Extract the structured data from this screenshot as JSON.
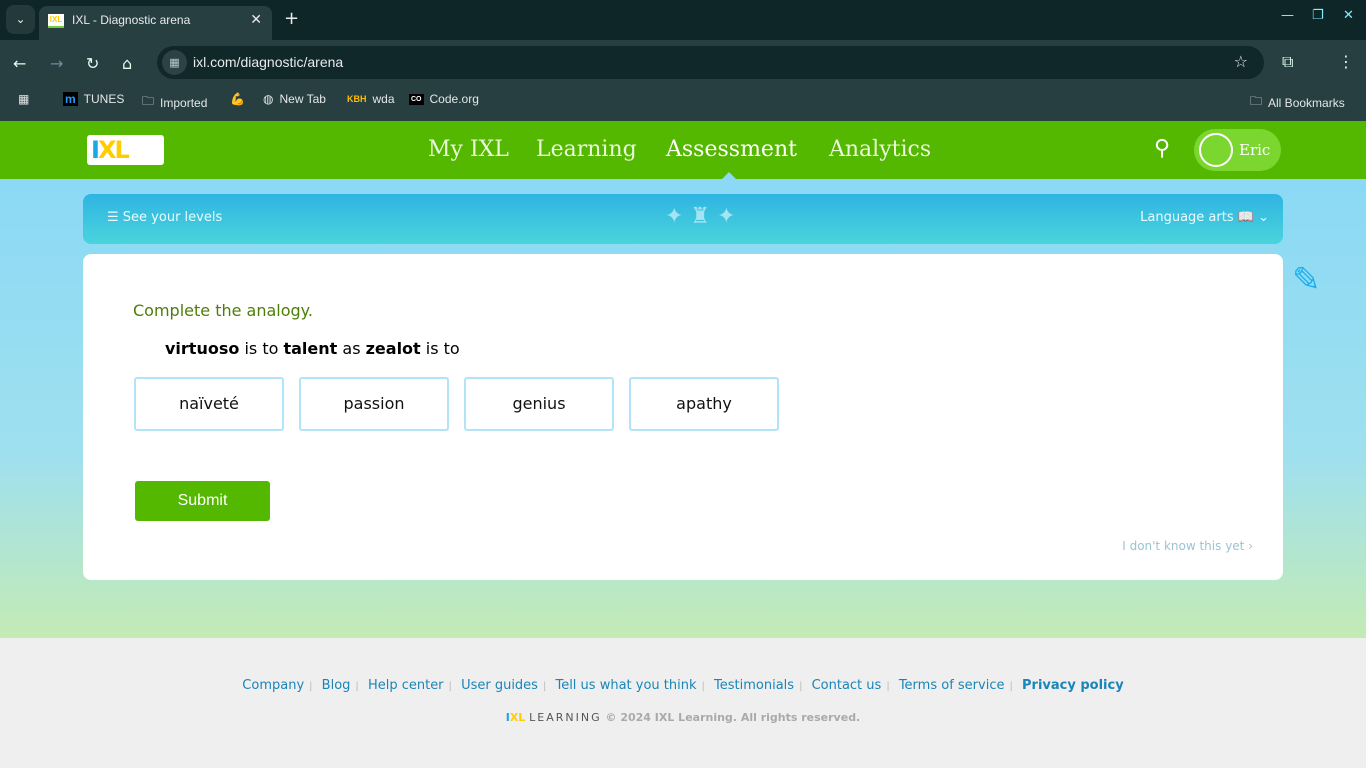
{
  "browser": {
    "tab_title": "IXL - Diagnostic arena",
    "url": "ixl.com/diagnostic/arena",
    "bookmarks": [
      {
        "label": "TUNES",
        "icon": "m-icon"
      },
      {
        "label": "Imported",
        "icon": "folder-icon"
      },
      {
        "label": "",
        "icon": "flexed-biceps-icon"
      },
      {
        "label": "New Tab",
        "icon": "globe-icon"
      },
      {
        "label": "wda",
        "icon": "kbh-icon"
      },
      {
        "label": "Code.org",
        "icon": "code-org-icon"
      }
    ],
    "all_bookmarks": "All Bookmarks"
  },
  "header": {
    "logo": "IXL",
    "nav": [
      "My IXL",
      "Learning",
      "Assessment",
      "Analytics"
    ],
    "active": "Assessment",
    "user": "Eric"
  },
  "banner": {
    "levels": "See your levels",
    "subject": "Language arts"
  },
  "question": {
    "prompt": "Complete the analogy.",
    "w1": "virtuoso",
    "t1": " is to ",
    "w2": "talent",
    "t2": " as ",
    "w3": "zealot",
    "t3": " is to",
    "options": [
      "naïveté",
      "passion",
      "genius",
      "apathy"
    ],
    "submit": "Submit",
    "idk": "I don't know this yet ›"
  },
  "footer": {
    "links": [
      "Company",
      "Blog",
      "Help center",
      "User guides",
      "Tell us what you think",
      "Testimonials",
      "Contact us",
      "Terms of service",
      "Privacy policy"
    ],
    "brand": "LEARNING",
    "copyright": "© 2024 IXL Learning. All rights reserved."
  },
  "colors": {
    "ixl_green": "#54b800",
    "sky": "#8bd9f5",
    "link": "#1a85b8"
  }
}
